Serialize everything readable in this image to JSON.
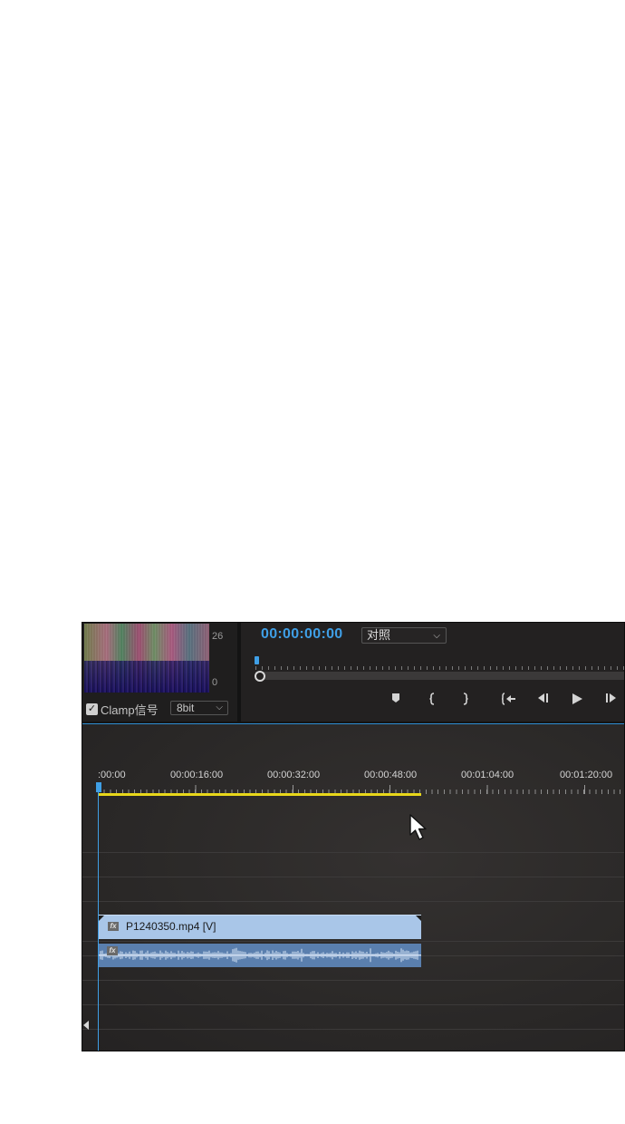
{
  "scope": {
    "scale_top": "26",
    "scale_bottom": "0",
    "clamp_checked": true,
    "clamp_label": "Clamp信号",
    "bit_depth_value": "8bit"
  },
  "monitor": {
    "timecode": "00:00:00:00",
    "compare_select_value": "对照",
    "transport_icons": [
      "marker-icon",
      "mark-in-icon",
      "mark-out-icon",
      "go-to-in-icon",
      "step-back-icon",
      "play-icon",
      "step-forward-icon"
    ]
  },
  "timeline": {
    "ruler_labels": [
      ":00:00",
      "00:00:16:00",
      "00:00:32:00",
      "00:00:48:00",
      "00:01:04:00",
      "00:01:20:00"
    ],
    "video_clip_name": "P1240350.mp4 [V]",
    "fx_badge": "fx"
  },
  "colors": {
    "accent_blue": "#3f9fe6",
    "work_area_yellow": "#e8d71a",
    "video_clip": "#a9c6e8",
    "audio_clip": "#5a7fae",
    "panel_bg": "#252323"
  }
}
